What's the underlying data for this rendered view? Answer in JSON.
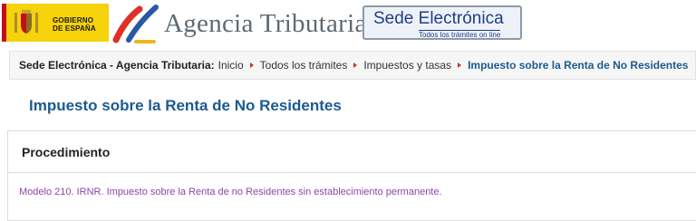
{
  "header": {
    "gov_logo_line1": "GOBIERNO",
    "gov_logo_line2": "DE ESPAÑA",
    "agency_name": "Agencia Tributaria",
    "sede_title": "Sede Electrónica",
    "sede_subtitle": "Todos los trámites on line"
  },
  "breadcrumb": {
    "site_label": "Sede Electrónica - Agencia Tributaria:",
    "items": [
      "Inicio",
      "Todos los trámites",
      "Impuestos y tasas"
    ],
    "current": "Impuesto sobre la Renta de No Residentes"
  },
  "page": {
    "title": "Impuesto sobre la Renta de No Residentes"
  },
  "procedure": {
    "heading": "Procedimiento",
    "link_text": "Modelo 210. IRNR. Impuesto sobre la Renta de no Residentes sin establecimiento permanente."
  },
  "colors": {
    "accent_blue": "#1c5a8f",
    "breadcrumb_arrow": "#c0392b",
    "visited_link": "#8e44ad",
    "gov_yellow": "#f5d20a"
  },
  "icons": [
    "spain-coat-of-arms-icon",
    "agencia-tributaria-logo-icon",
    "breadcrumb-arrow-icon"
  ]
}
